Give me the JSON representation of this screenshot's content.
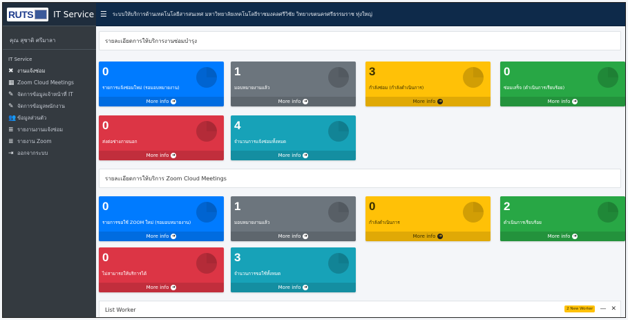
{
  "app": {
    "logo_text": "RUTS",
    "brand_title": "IT Service",
    "top_title": "ระบบให้บริการด้านเทคโนโลยีสารสนเทศ มหาวิทยาลัยเทคโนโลยีราชมงคลศรีวิชัย วิทยาเขตนครศรีธรรมราช ทุ่งใหญ่"
  },
  "sidebar": {
    "user_name": "คุณ สุชาติ ศรีมาลา",
    "header": "IT Service",
    "items": [
      {
        "label": "งานแจ้งซ่อม",
        "icon": "tools-icon",
        "glyph": "✖"
      },
      {
        "label": "Zoom Cloud Meetings",
        "icon": "table-icon",
        "glyph": "▦"
      },
      {
        "label": "จัดการข้อมูลเจ้าหน้าที่ IT",
        "icon": "edit-icon",
        "glyph": "✎"
      },
      {
        "label": "จัดการข้อมูลพนักงาน",
        "icon": "edit-icon",
        "glyph": "✎"
      },
      {
        "label": "ข้อมูลส่วนตัว",
        "icon": "users-icon",
        "glyph": "👥"
      },
      {
        "label": "รายงานงานแจ้งซ่อม",
        "icon": "database-icon",
        "glyph": "≣"
      },
      {
        "label": "รายงาน Zoom",
        "icon": "database-icon",
        "glyph": "≣"
      },
      {
        "label": "ออกจากระบบ",
        "icon": "logout-icon",
        "glyph": "⇥"
      }
    ]
  },
  "repair": {
    "section_title": "รายละเอียดการให้บริการงานซ่อมบำรุง",
    "boxes": [
      {
        "value": "0",
        "label": "รายการแจ้งซ่อมใหม่ (รอมอบหมายงาน)",
        "more": "More info"
      },
      {
        "value": "1",
        "label": "มอบหมายงานแล้ว",
        "more": "More info"
      },
      {
        "value": "3",
        "label": "กำลังซ่อม (กำลังดำเนินการ)",
        "more": "More info"
      },
      {
        "value": "0",
        "label": "ซ่อมเสร็จ (ดำเนินการเรียบร้อย)",
        "more": "More info"
      },
      {
        "value": "0",
        "label": "ส่งต่อช่างภายนอก",
        "more": "More info"
      },
      {
        "value": "4",
        "label": "จำนวนการแจ้งซ่อมทั้งหมด",
        "more": "More info"
      }
    ]
  },
  "zoom": {
    "section_title": "รายละเอียดการให้บริการ Zoom Cloud Meetings",
    "boxes": [
      {
        "value": "0",
        "label": "รายการขอใช้ ZOOM ใหม่ (รอมอบหมายงาน)",
        "more": "More info"
      },
      {
        "value": "1",
        "label": "มอบหมายงานแล้ว",
        "more": "More info"
      },
      {
        "value": "0",
        "label": "กำลังดำเนินการ",
        "more": "More info"
      },
      {
        "value": "2",
        "label": "ดำเนินการเรียบร้อย",
        "more": "More info"
      },
      {
        "value": "0",
        "label": "ไม่สามารถให้บริการได้",
        "more": "More info"
      },
      {
        "value": "3",
        "label": "จำนวนการขอใช้ทั้งหมด",
        "more": "More info"
      }
    ]
  },
  "list_worker": {
    "title": "List Worker",
    "badge": "2 New Worker",
    "minimize": "—",
    "close": "✕"
  }
}
